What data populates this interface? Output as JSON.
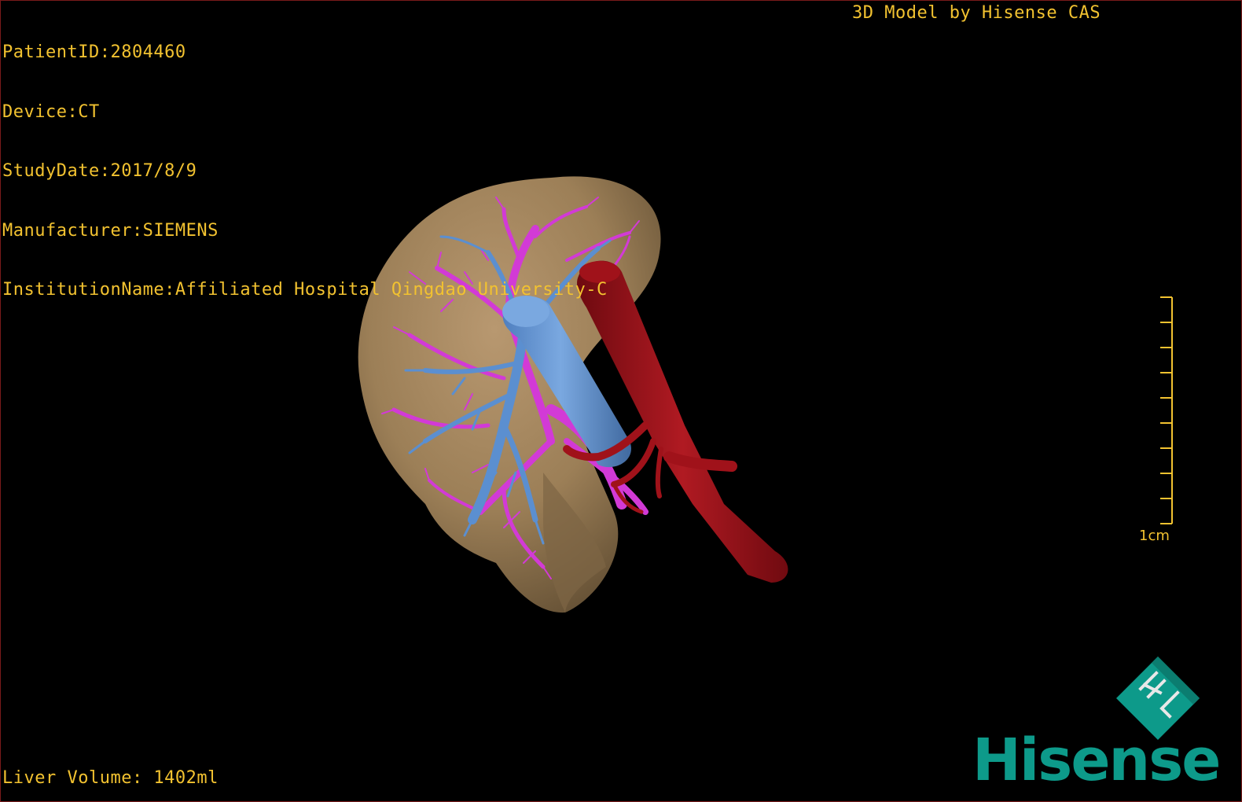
{
  "patient_info": {
    "lines": [
      "PatientID:2804460",
      "Device:CT",
      "StudyDate:2017/8/9",
      "Manufacturer:SIEMENS",
      "InstitutionName:Affiliated Hospital Qingdao University-C"
    ]
  },
  "credit": "3D Model by Hisense CAS",
  "liver_volume": "Liver Volume: 1402ml",
  "scale": {
    "label": "1cm",
    "tick_count": 10
  },
  "brand": {
    "name": "Hisense",
    "color": "#0d9a8a",
    "icon": "hisense-logo-icon"
  },
  "model": {
    "structures": [
      "liver",
      "portal-vein",
      "hepatic-vein",
      "inferior-vena-cava",
      "hepatic-artery"
    ],
    "colors": {
      "liver": "#9c7f57",
      "portal_vein": "#d23ad6",
      "hepatic_vein": "#5b8fd0",
      "ivc": "#6a9bd6",
      "artery": "#a0121a"
    }
  }
}
